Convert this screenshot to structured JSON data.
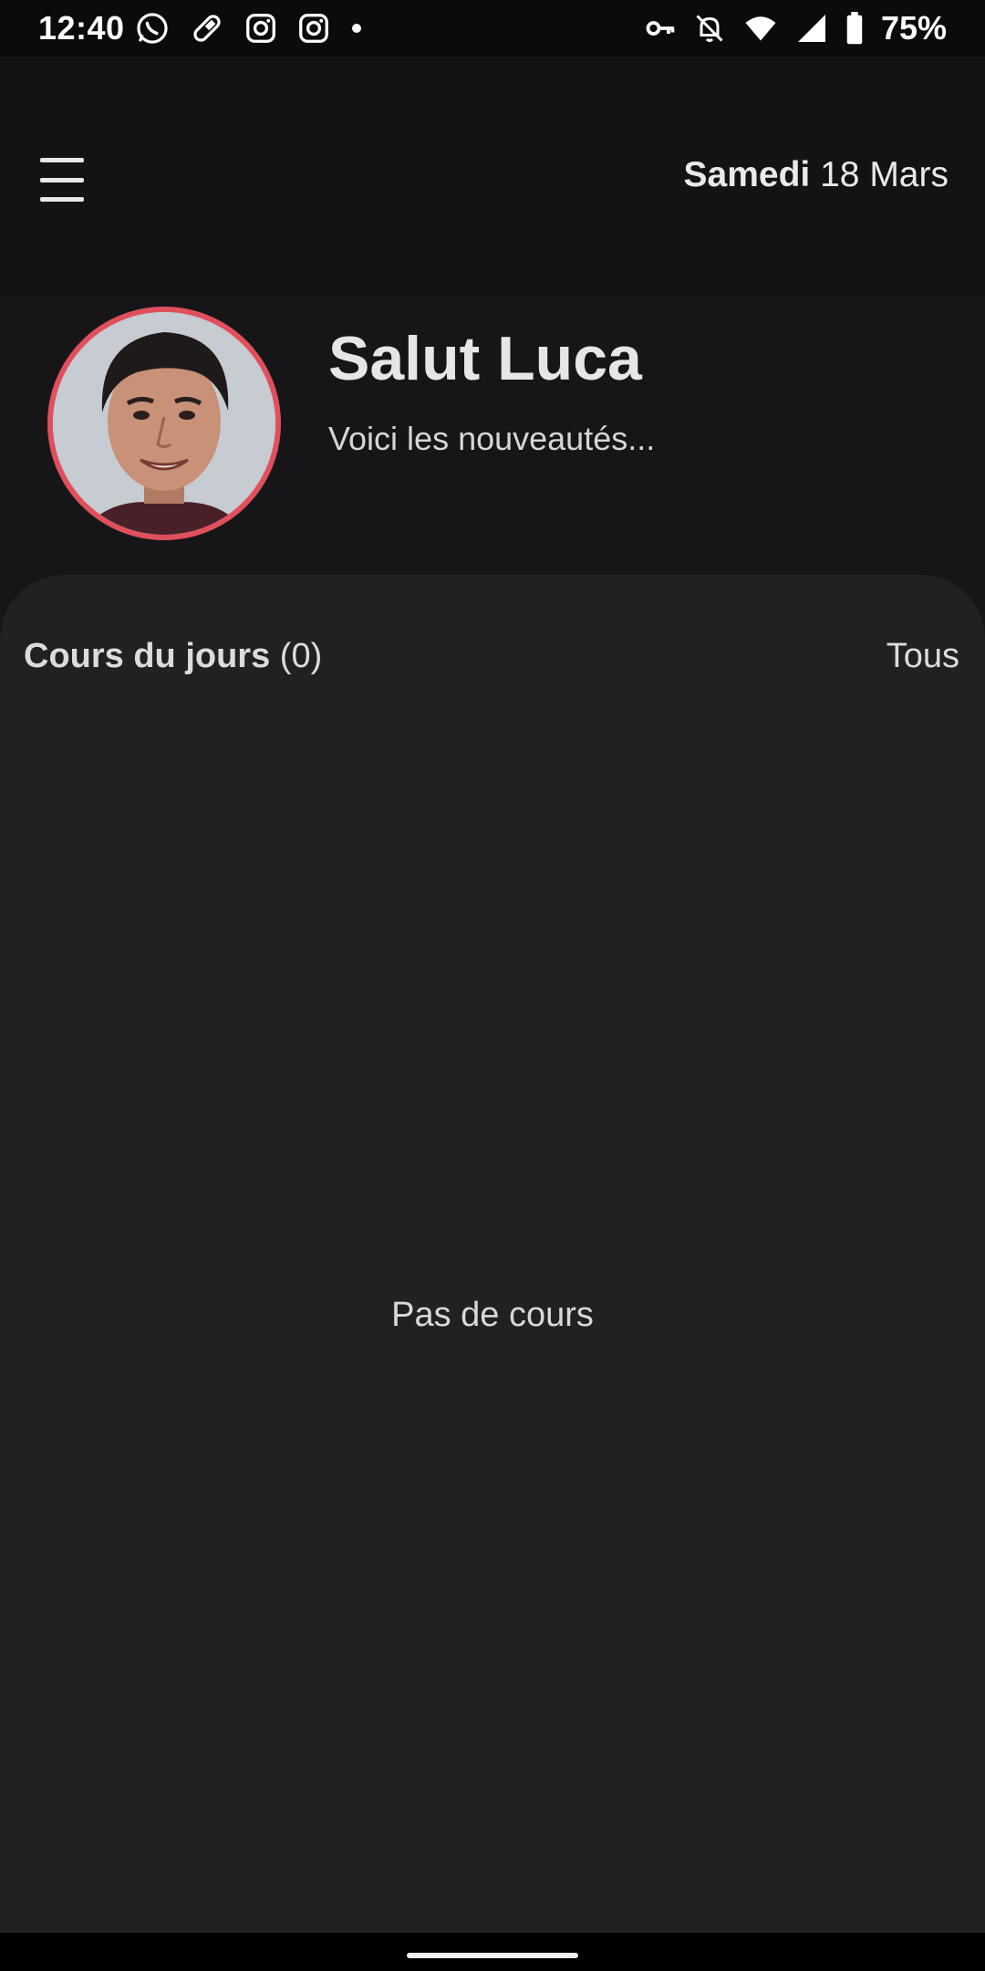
{
  "status_bar": {
    "time": "12:40",
    "battery": "75%",
    "left_icons": [
      "whatsapp-icon",
      "pill-icon",
      "instagram-icon",
      "instagram-icon",
      "dot-icon"
    ],
    "right_icons": [
      "vpn-key-icon",
      "bell-off-icon",
      "wifi-icon",
      "signal-icon",
      "battery-icon"
    ]
  },
  "header": {
    "day": "Samedi",
    "date": "18 Mars"
  },
  "greeting": {
    "title": "Salut Luca",
    "subtitle": "Voici les nouveautés..."
  },
  "courses": {
    "title": "Cours du jours",
    "count": "(0)",
    "see_all": "Tous",
    "empty_message": "Pas de cours"
  },
  "colors": {
    "accent_ring": "#e0505c",
    "card_bg": "#212122",
    "header_bg": "#131315"
  }
}
